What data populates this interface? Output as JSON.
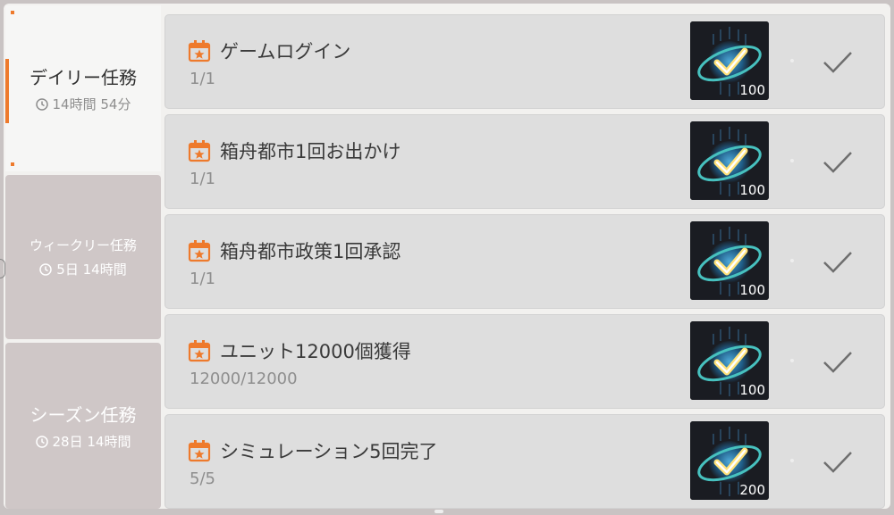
{
  "colors": {
    "accent": "#ee7a2c",
    "row_bg": "#dedede",
    "inactive_tab": "#cfc7c7"
  },
  "tabs": [
    {
      "title": "デイリー任務",
      "timer": "14時間 54分",
      "active": true
    },
    {
      "title": "ウィークリー任務",
      "timer": "5日 14時間",
      "active": false
    },
    {
      "title": "シーズン任務",
      "timer": "28日 14時間",
      "active": false
    }
  ],
  "quests": [
    {
      "title": "ゲームログイン",
      "progress": "1/1",
      "reward": "100",
      "completed": true
    },
    {
      "title": "箱舟都市1回お出かけ",
      "progress": "1/1",
      "reward": "100",
      "completed": true
    },
    {
      "title": "箱舟都市政策1回承認",
      "progress": "1/1",
      "reward": "100",
      "completed": true
    },
    {
      "title": "ユニット12000個獲得",
      "progress": "12000/12000",
      "reward": "100",
      "completed": true
    },
    {
      "title": "シミュレーション5回完了",
      "progress": "5/5",
      "reward": "200",
      "completed": true
    }
  ],
  "icons": {
    "calendar": "calendar-star-icon",
    "clock": "clock-icon",
    "check": "check-icon",
    "reward": "activity-points-icon"
  }
}
